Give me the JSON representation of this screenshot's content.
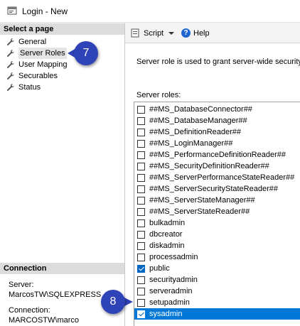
{
  "window": {
    "title": "Login - New"
  },
  "select_page": {
    "header": "Select a page",
    "items": [
      {
        "label": "General"
      },
      {
        "label": "Server Roles"
      },
      {
        "label": "User Mapping"
      },
      {
        "label": "Securables"
      },
      {
        "label": "Status"
      }
    ]
  },
  "connection": {
    "header": "Connection",
    "server_label": "Server:",
    "server_value": "MarcosTW\\SQLEXPRESS",
    "connection_label": "Connection:",
    "connection_value": "MARCOSTW\\marco"
  },
  "toolbar": {
    "script_label": "Script",
    "help_label": "Help"
  },
  "description": "Server role is used to grant server-wide security p",
  "roles_label": "Server roles:",
  "roles": [
    {
      "name": "##MS_DatabaseConnector##",
      "checked": false
    },
    {
      "name": "##MS_DatabaseManager##",
      "checked": false
    },
    {
      "name": "##MS_DefinitionReader##",
      "checked": false
    },
    {
      "name": "##MS_LoginManager##",
      "checked": false
    },
    {
      "name": "##MS_PerformanceDefinitionReader##",
      "checked": false
    },
    {
      "name": "##MS_SecurityDefinitionReader##",
      "checked": false
    },
    {
      "name": "##MS_ServerPerformanceStateReader##",
      "checked": false
    },
    {
      "name": "##MS_ServerSecurityStateReader##",
      "checked": false
    },
    {
      "name": "##MS_ServerStateManager##",
      "checked": false
    },
    {
      "name": "##MS_ServerStateReader##",
      "checked": false
    },
    {
      "name": "bulkadmin",
      "checked": false
    },
    {
      "name": "dbcreator",
      "checked": false
    },
    {
      "name": "diskadmin",
      "checked": false
    },
    {
      "name": "processadmin",
      "checked": false
    },
    {
      "name": "public",
      "checked": true
    },
    {
      "name": "securityadmin",
      "checked": false
    },
    {
      "name": "serveradmin",
      "checked": false
    },
    {
      "name": "setupadmin",
      "checked": false
    },
    {
      "name": "sysadmin",
      "checked": true,
      "selected": true
    }
  ],
  "callouts": {
    "first": "7",
    "second": "8"
  },
  "colors": {
    "accent": "#0078d7",
    "callout": "#2f43b8"
  }
}
